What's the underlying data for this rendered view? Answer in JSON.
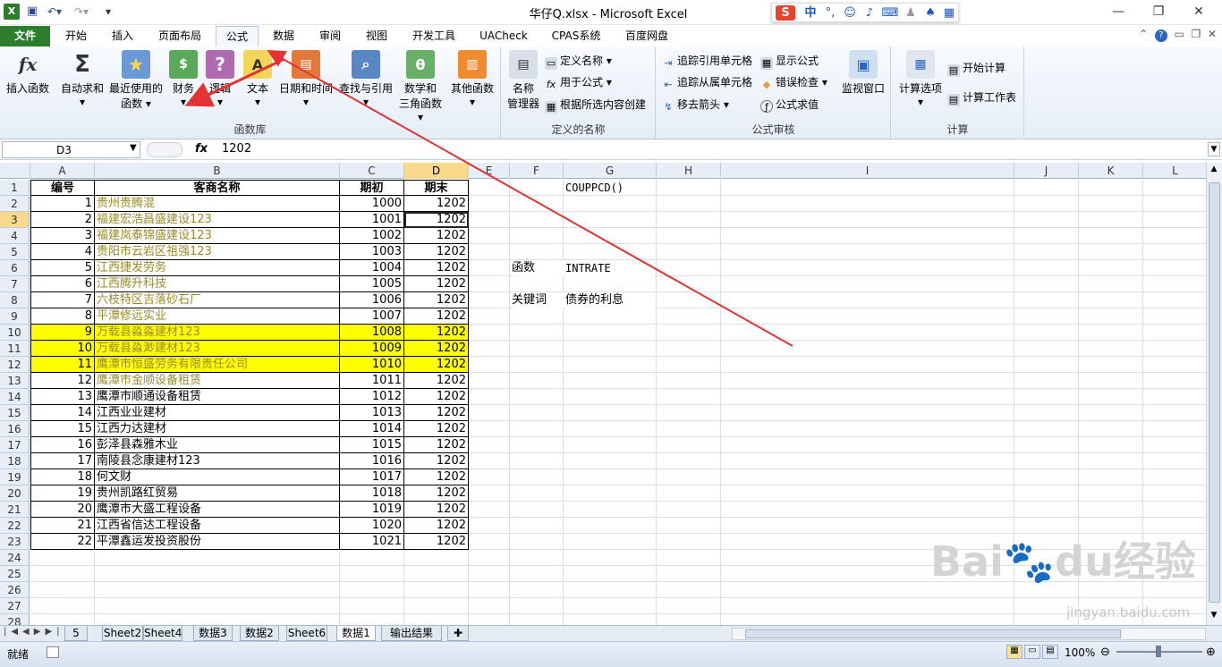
{
  "window": {
    "title": "华仔Q.xlsx - Microsoft Excel",
    "min_icon": "minimize-icon",
    "max_icon": "restore-icon",
    "close_icon": "close-icon"
  },
  "ime": {
    "brand": "S",
    "lang": "中",
    "punct": "°,"
  },
  "tabs": [
    "文件",
    "开始",
    "插入",
    "页面布局",
    "公式",
    "数据",
    "审阅",
    "视图",
    "开发工具",
    "UACheck",
    "CPAS系统",
    "百度网盘"
  ],
  "active_tab": "公式",
  "ribbon": {
    "insert_function": "插入函数",
    "autosum": "自动求和",
    "recent": "最近使用的",
    "recent2": "函数",
    "financial": "财务",
    "logical": "逻辑",
    "text": "文本",
    "datetime": "日期和时间",
    "lookup": "查找与引用",
    "math": "数学和",
    "math2": "三角函数",
    "other": "其他函数",
    "group_library": "函数库",
    "name_manager": "名称",
    "name_manager2": "管理器",
    "define_name": "定义名称",
    "use_in_formula": "用于公式",
    "create_from_sel": "根据所选内容创建",
    "group_names": "定义的名称",
    "trace_precedents": "追踪引用单元格",
    "trace_dependents": "追踪从属单元格",
    "remove_arrows": "移去箭头",
    "show_formulas": "显示公式",
    "error_check": "错误检查",
    "evaluate": "公式求值",
    "watch": "监视窗口",
    "group_audit": "公式审核",
    "calc_options": "计算选项",
    "calc_now": "开始计算",
    "calc_sheet": "计算工作表",
    "group_calc": "计算",
    "colors": {
      "accent": "#2c7d2c",
      "highlight": "#ffff00",
      "selected_header": "#f9d98c",
      "arrow": "#e53333"
    }
  },
  "formula_bar": {
    "name_box": "D3",
    "fx": "fx",
    "value": "1202"
  },
  "columns": [
    "A",
    "B",
    "C",
    "D",
    "E",
    "F",
    "G",
    "H",
    "I",
    "J",
    "K",
    "L"
  ],
  "selected_column": "D",
  "selected_row": "3",
  "header_row": {
    "a": "编号",
    "b": "客商名称",
    "c": "期初",
    "d": "期末"
  },
  "rows": [
    {
      "r": "2",
      "a": "1",
      "b": "贵州贵腾混",
      "c": "1000",
      "d": "1202",
      "style": "olive"
    },
    {
      "r": "3",
      "a": "2",
      "b": "福建宏浩昌盛建设123",
      "c": "1001",
      "d": "1202",
      "style": "olive"
    },
    {
      "r": "4",
      "a": "3",
      "b": "福建岚泰锦盛建设123",
      "c": "1002",
      "d": "1202",
      "style": "olive"
    },
    {
      "r": "5",
      "a": "4",
      "b": "贵阳市云岩区祖强123",
      "c": "1003",
      "d": "1202",
      "style": "olive"
    },
    {
      "r": "6",
      "a": "5",
      "b": "江西捷发劳务",
      "c": "1004",
      "d": "1202",
      "style": "olive"
    },
    {
      "r": "7",
      "a": "6",
      "b": "江西腾升科技",
      "c": "1005",
      "d": "1202",
      "style": "olive"
    },
    {
      "r": "8",
      "a": "7",
      "b": "六枝特区吉落砂石厂",
      "c": "1006",
      "d": "1202",
      "style": "olive"
    },
    {
      "r": "9",
      "a": "8",
      "b": "平潭修远实业",
      "c": "1007",
      "d": "1202",
      "style": "olive"
    },
    {
      "r": "10",
      "a": "9",
      "b": "万载县淼淼建材123",
      "c": "1008",
      "d": "1202",
      "style": "yellow"
    },
    {
      "r": "11",
      "a": "10",
      "b": "万载县淼渺建材123",
      "c": "1009",
      "d": "1202",
      "style": "yellow"
    },
    {
      "r": "12",
      "a": "11",
      "b": "鹰潭市恒盛劳务有限责任公司",
      "c": "1010",
      "d": "1202",
      "style": "yellow"
    },
    {
      "r": "13",
      "a": "12",
      "b": "鹰潭市金顺设备租赁",
      "c": "1011",
      "d": "1202",
      "style": "olive"
    },
    {
      "r": "14",
      "a": "13",
      "b": "鹰潭市顺通设备租赁",
      "c": "1012",
      "d": "1202",
      "style": "plain"
    },
    {
      "r": "15",
      "a": "14",
      "b": "江西业业建材",
      "c": "1013",
      "d": "1202",
      "style": "plain"
    },
    {
      "r": "16",
      "a": "15",
      "b": "江西力达建材",
      "c": "1014",
      "d": "1202",
      "style": "plain"
    },
    {
      "r": "17",
      "a": "16",
      "b": "彭泽县森雅木业",
      "c": "1015",
      "d": "1202",
      "style": "plain"
    },
    {
      "r": "18",
      "a": "17",
      "b": "南陵县念康建材123",
      "c": "1016",
      "d": "1202",
      "style": "plain"
    },
    {
      "r": "19",
      "a": "18",
      "b": "何文财",
      "c": "1017",
      "d": "1202",
      "style": "plain"
    },
    {
      "r": "20",
      "a": "19",
      "b": "贵州凯路红贸易",
      "c": "1018",
      "d": "1202",
      "style": "plain"
    },
    {
      "r": "21",
      "a": "20",
      "b": "鹰潭市大盛工程设备",
      "c": "1019",
      "d": "1202",
      "style": "plain"
    },
    {
      "r": "22",
      "a": "21",
      "b": "江西省信达工程设备",
      "c": "1020",
      "d": "1202",
      "style": "plain"
    },
    {
      "r": "23",
      "a": "22",
      "b": "平潭鑫运发投资股份",
      "c": "1021",
      "d": "1202",
      "style": "plain"
    }
  ],
  "empty_rows": [
    "24",
    "25",
    "26",
    "27",
    "28"
  ],
  "side_notes": {
    "g1": "COUPPCD()",
    "f6": "函数",
    "g6": "INTRATE",
    "f8": "关键词",
    "g8": "债券的利息"
  },
  "sheets": [
    "5",
    "Sheet2",
    "Sheet4",
    "数据3",
    "数据2",
    "Sheet6",
    "数据1",
    "输出结果"
  ],
  "active_sheet": "数据1",
  "status": {
    "ready": "就绪",
    "zoom": "100%"
  },
  "watermark": {
    "logo": "Baidu经验",
    "url": "jingyan.baidu.com"
  }
}
